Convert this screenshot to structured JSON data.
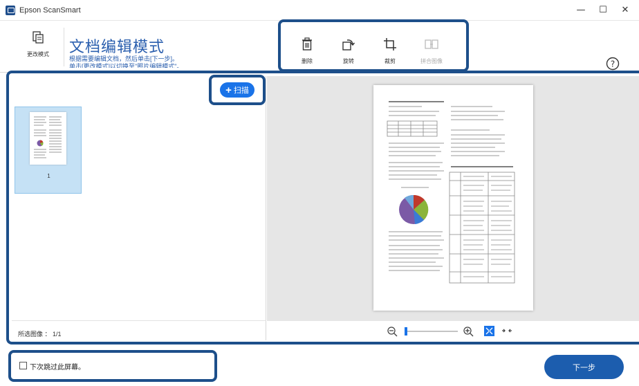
{
  "window": {
    "title": "Epson ScanSmart",
    "controls": {
      "minimize": "—",
      "maximize": "☐",
      "close": "✕"
    }
  },
  "header": {
    "change_mode_label": "更改模式",
    "title": "文档编辑模式",
    "description_line1": "根据需要编辑文档，然后单击[下一步]。",
    "description_line2": "单击[更改模式]以切换至\"照片编辑模式\"。",
    "help_label": "帮助"
  },
  "toolbar": {
    "delete_label": "删除",
    "rotate_label": "旋转",
    "crop_label": "裁剪",
    "stitch_label": "拼合图像"
  },
  "left_pane": {
    "scan_label": "扫描",
    "thumbnail_number": "1",
    "selected_count": "所选图像 ： 1/1"
  },
  "bottom": {
    "skip_label": "下次跳过此屏幕。",
    "next_label": "下一步"
  },
  "colors": {
    "accent": "#1d4f8a",
    "button_blue": "#1a73e8",
    "next_button": "#1c5dae",
    "title_blue": "#2b5fae",
    "selection": "#c5e1f5"
  }
}
